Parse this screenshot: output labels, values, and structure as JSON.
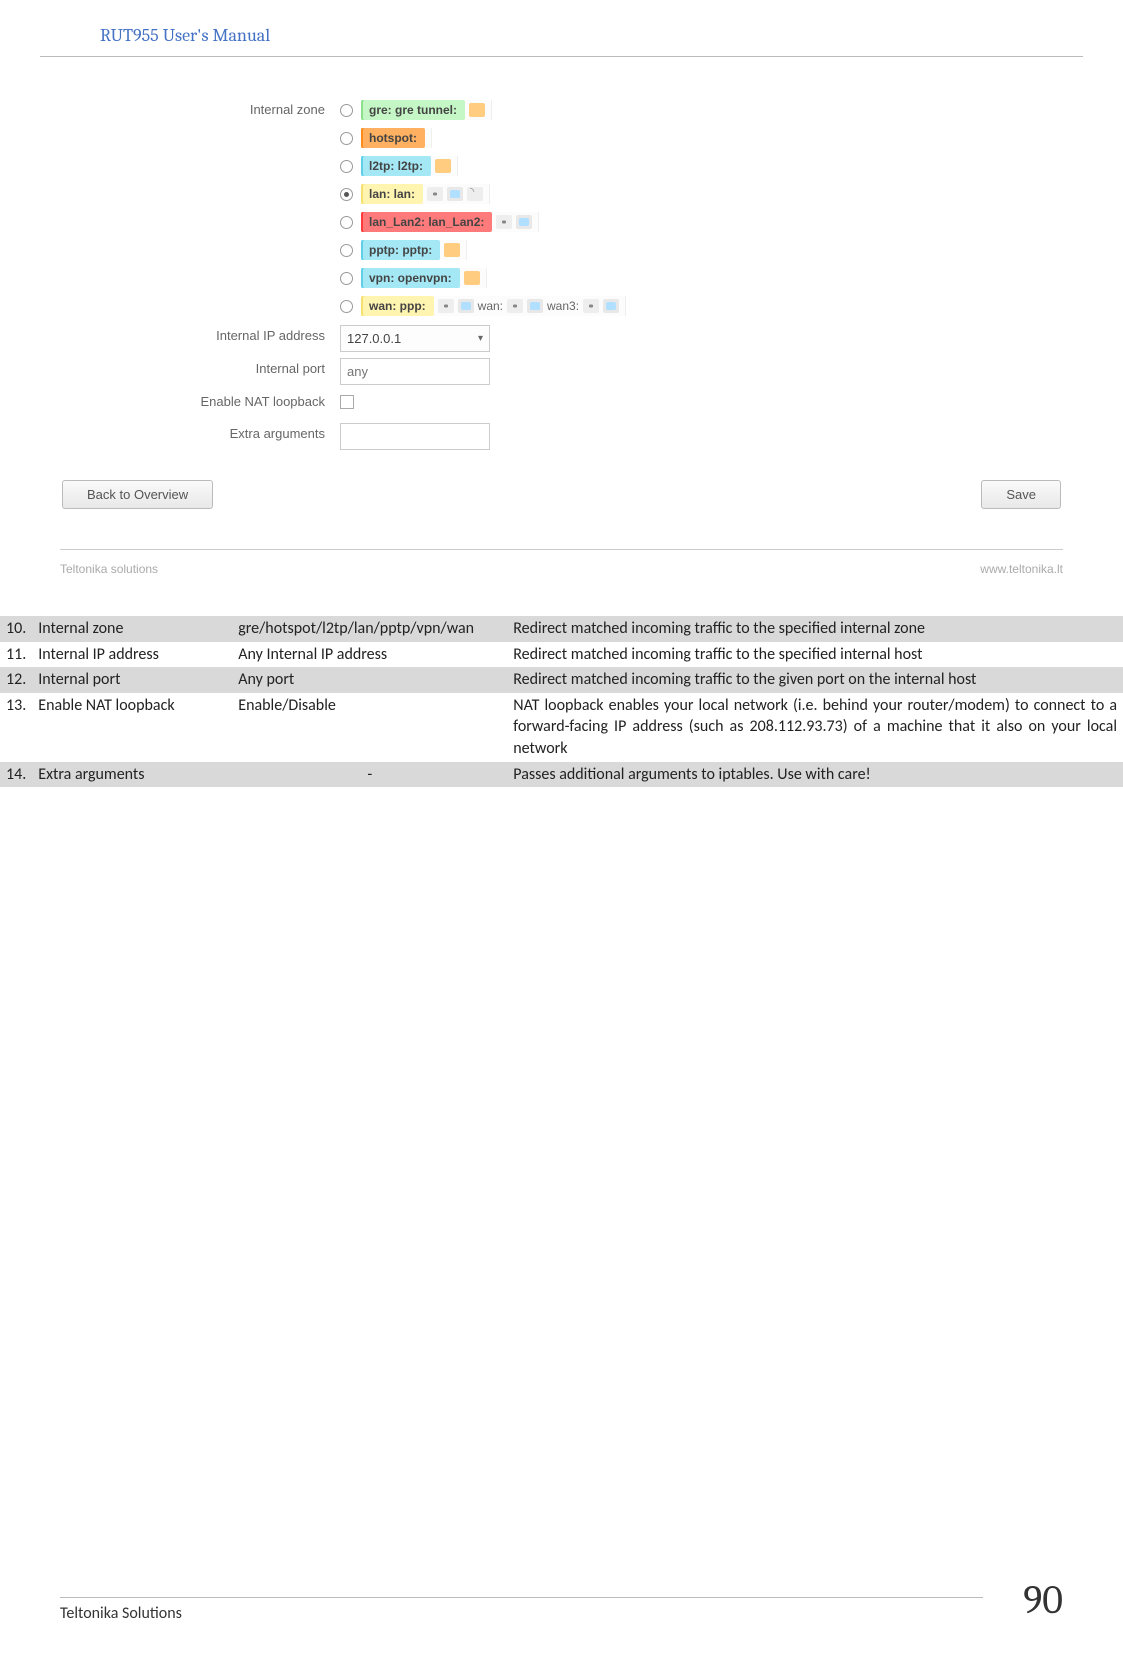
{
  "header": {
    "title": "RUT955 User's Manual"
  },
  "screenshot": {
    "labels": {
      "internal_zone": "Internal zone",
      "internal_ip": "Internal IP address",
      "internal_port": "Internal port",
      "nat_loopback": "Enable NAT loopback",
      "extra_args": "Extra arguments"
    },
    "zones": [
      {
        "key": "gre",
        "label": "gre: gre tunnel:",
        "checked": false,
        "color": "t-green",
        "icons": [
          "mi-vpn"
        ]
      },
      {
        "key": "hotspot",
        "label": "hotspot:",
        "checked": false,
        "color": "t-orange",
        "icons": []
      },
      {
        "key": "l2tp",
        "label": "l2tp: l2tp:",
        "checked": false,
        "color": "t-cyan",
        "icons": [
          "mi-vpn"
        ]
      },
      {
        "key": "lan",
        "label": "lan: lan:",
        "checked": true,
        "color": "t-yellow",
        "icons": [
          "mi-host",
          "mi-ppp",
          "mi-wifi"
        ]
      },
      {
        "key": "lan2",
        "label": "lan_Lan2: lan_Lan2:",
        "checked": false,
        "color": "t-red",
        "icons": [
          "mi-host",
          "mi-ppp"
        ]
      },
      {
        "key": "pptp",
        "label": "pptp: pptp:",
        "checked": false,
        "color": "t-cyan",
        "icons": [
          "mi-vpn"
        ]
      },
      {
        "key": "vpn",
        "label": "vpn: openvpn:",
        "checked": false,
        "color": "t-cyan",
        "icons": [
          "mi-vpn"
        ]
      },
      {
        "key": "wan",
        "label": "wan: ppp:",
        "checked": false,
        "color": "t-yellow",
        "icons": [
          "mi-host",
          "mi-ppp"
        ],
        "extra_after": [
          {
            "text": "wan:",
            "icons": [
              "mi-host",
              "mi-ppp"
            ]
          },
          {
            "text": "wan3:",
            "icons": [
              "mi-host",
              "mi-ppp"
            ]
          }
        ]
      }
    ],
    "internal_ip_value": "127.0.0.1",
    "internal_port_placeholder": "any",
    "buttons": {
      "back": "Back to Overview",
      "save": "Save"
    },
    "footer_left": "Teltonika solutions",
    "footer_right": "www.teltonika.lt"
  },
  "table": {
    "rows": [
      {
        "n": "10.",
        "field": "Internal zone",
        "value": "gre/hotspot/l2tp/lan/pptp/vpn/wan",
        "value_center": false,
        "desc": "Redirect matched incoming traffic to the specified internal zone"
      },
      {
        "n": "11.",
        "field": "Internal IP address",
        "value": "Any Internal IP address",
        "value_center": false,
        "desc": "Redirect matched incoming traffic to the specified internal host"
      },
      {
        "n": "12.",
        "field": "Internal port",
        "value": "Any port",
        "value_center": false,
        "desc": "Redirect matched incoming traffic to the given port on the internal host"
      },
      {
        "n": "13.",
        "field": "Enable NAT loopback",
        "value": "Enable/Disable",
        "value_center": false,
        "desc": "NAT loopback enables your local network (i.e. behind your router/modem) to connect to a forward-facing IP address (such as 208.112.93.73) of a machine that it also on your local network"
      },
      {
        "n": "14.",
        "field": "Extra arguments",
        "value": "-",
        "value_center": true,
        "desc": "Passes additional arguments to iptables. Use with care!"
      }
    ]
  },
  "footer": {
    "left": "Teltonika Solutions",
    "page_number": "90"
  }
}
